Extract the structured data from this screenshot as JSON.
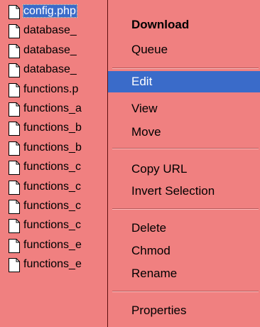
{
  "file_list": {
    "files": [
      {
        "name": "config.php",
        "selected": true
      },
      {
        "name": "database_",
        "selected": false
      },
      {
        "name": "database_",
        "selected": false
      },
      {
        "name": "database_",
        "selected": false
      },
      {
        "name": "functions.p",
        "selected": false
      },
      {
        "name": "functions_a",
        "selected": false
      },
      {
        "name": "functions_b",
        "selected": false
      },
      {
        "name": "functions_b",
        "selected": false
      },
      {
        "name": "functions_c",
        "selected": false
      },
      {
        "name": "functions_c",
        "selected": false
      },
      {
        "name": "functions_c",
        "selected": false
      },
      {
        "name": "functions_c",
        "selected": false
      },
      {
        "name": "functions_e",
        "selected": false
      },
      {
        "name": "functions_e",
        "selected": false
      }
    ]
  },
  "context_menu": {
    "download": "Download",
    "queue": "Queue",
    "edit": "Edit",
    "view": "View",
    "move": "Move",
    "copy_url": "Copy URL",
    "invert_selection": "Invert Selection",
    "delete": "Delete",
    "chmod": "Chmod",
    "rename": "Rename",
    "properties": "Properties",
    "highlighted_item": "Edit"
  },
  "colors": {
    "background": "#f08080",
    "highlight": "#3a6bc9",
    "highlight_text": "#ffffff"
  },
  "icons": {
    "file": "document-icon"
  }
}
